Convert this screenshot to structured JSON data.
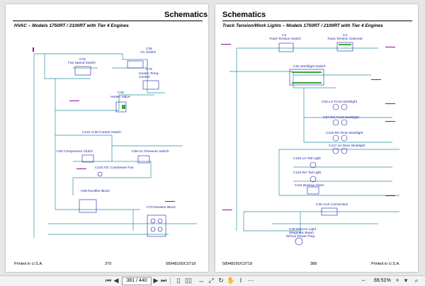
{
  "left_page": {
    "header": "Schematics",
    "subtitle": "HVAC – Models 1750RT / 2100RT with Tier 4 Engines",
    "footer_left": "Printed in U.S.A.",
    "page_number": "379",
    "footer_right": "58948165/C0718",
    "components": {
      "c75": "C75",
      "c75_name": "Fan Speed Switch",
      "c45": "C45",
      "c45_name": "AC Switch",
      "c76": "C76",
      "c76_name": "Heater Temp. Control",
      "c29": "C29",
      "c29_name": "Heater Valve",
      "c122": "C122 Cold Control Switch",
      "c60": "C60 Compressor Clutch",
      "c68": "C68 AC Pressure Switch",
      "c110": "C110 A/C Condenser Fan",
      "c69": "C69 Rectifier Block",
      "c70": "C70 Resistor Block"
    }
  },
  "right_page": {
    "header": "Schematics",
    "subtitle": "Track Tension/Work Lights – Models 1750RT / 2100RT with Tier 4 Engines",
    "footer_left": "58948165/C0718",
    "page_number": "388",
    "footer_right": "Printed in U.S.A.",
    "components": {
      "c3": "C3",
      "c3_name": "Track Tension Switch",
      "c4": "C4",
      "c4_name": "Track Tension Solenoid",
      "c81": "C81 Worklight Switch",
      "c53": "C53 LH Front Worklight",
      "c57": "C57 RH Front Worklight",
      "c116": "C116 RH Rear Worklight",
      "c117": "C117 LH Rear Worklight",
      "c118": "C118 LH Tail Light",
      "c115": "C115 RH Tail Light",
      "c111": "C111 Backup Alarm",
      "c26": "C26 AUX Connection",
      "c28_a": "C28 Beacon Light",
      "c28_b": "(Magnetic Base)",
      "c28_c": "W/Aux Power Plug"
    }
  },
  "toolbar": {
    "current_page": "381 / 440",
    "zoom": "69.51%"
  },
  "colors": {
    "wire": "#2a8fa0",
    "component": "#1d1da6",
    "connector_tag": "#a000a0",
    "highlight_green": "#3aa63a"
  }
}
